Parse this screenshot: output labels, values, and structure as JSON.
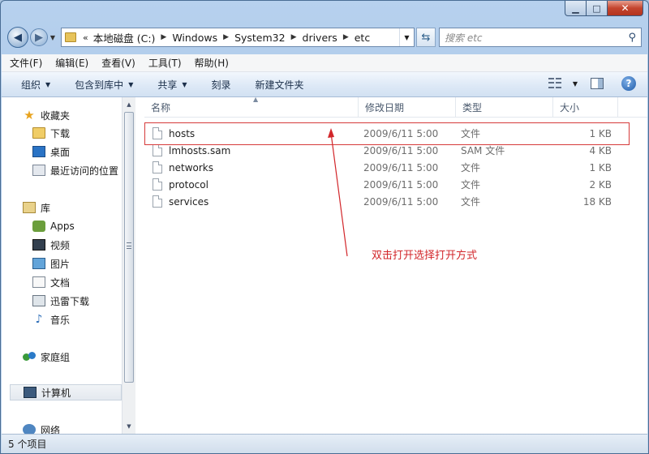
{
  "window": {
    "buttons": {
      "minimize": "▁",
      "maximize": "□",
      "close": "✕"
    }
  },
  "navigation": {
    "back_icon": "back-arrow-icon",
    "forward_icon": "forward-arrow-icon",
    "back_glyph": "◀",
    "forward_glyph": "▶"
  },
  "address": {
    "overflow_glyph": "«",
    "crumbs": [
      "本地磁盘 (C:)",
      "Windows",
      "System32",
      "drivers",
      "etc"
    ]
  },
  "search": {
    "placeholder": "搜索 etc"
  },
  "menu": [
    "文件(F)",
    "编辑(E)",
    "查看(V)",
    "工具(T)",
    "帮助(H)"
  ],
  "toolbar": {
    "items": [
      {
        "label": "组织",
        "has_caret": true
      },
      {
        "label": "包含到库中",
        "has_caret": true
      },
      {
        "label": "共享",
        "has_caret": true
      },
      {
        "label": "刻录",
        "has_caret": false
      },
      {
        "label": "新建文件夹",
        "has_caret": false
      }
    ]
  },
  "sidebar": {
    "items": [
      {
        "label": "收藏夹",
        "icon": "star-icon"
      },
      {
        "label": "下载",
        "icon": "downloads-folder-icon"
      },
      {
        "label": "桌面",
        "icon": "desktop-icon"
      },
      {
        "label": "最近访问的位置",
        "icon": "recent-places-icon"
      },
      {
        "label": "库",
        "icon": "libraries-icon"
      },
      {
        "label": "Apps",
        "icon": "apps-icon"
      },
      {
        "label": "视频",
        "icon": "video-icon"
      },
      {
        "label": "图片",
        "icon": "pictures-icon"
      },
      {
        "label": "文档",
        "icon": "documents-icon"
      },
      {
        "label": "迅雷下载",
        "icon": "thunder-download-icon"
      },
      {
        "label": "音乐",
        "icon": "music-icon"
      },
      {
        "label": "家庭组",
        "icon": "homegroup-icon"
      },
      {
        "label": "计算机",
        "icon": "computer-icon"
      },
      {
        "label": "网络",
        "icon": "network-icon"
      }
    ]
  },
  "columns": [
    "名称",
    "修改日期",
    "类型",
    "大小"
  ],
  "files": [
    {
      "name": "hosts",
      "date": "2009/6/11 5:00",
      "type": "文件",
      "size": "1 KB"
    },
    {
      "name": "lmhosts.sam",
      "date": "2009/6/11 5:00",
      "type": "SAM 文件",
      "size": "4 KB"
    },
    {
      "name": "networks",
      "date": "2009/6/11 5:00",
      "type": "文件",
      "size": "1 KB"
    },
    {
      "name": "protocol",
      "date": "2009/6/11 5:00",
      "type": "文件",
      "size": "2 KB"
    },
    {
      "name": "services",
      "date": "2009/6/11 5:00",
      "type": "文件",
      "size": "18 KB"
    }
  ],
  "annotation": {
    "text": "双击打开选择打开方式",
    "color": "#d2262a"
  },
  "status": {
    "text": "5 个项目"
  },
  "colors": {
    "accent": "#1d5aa8",
    "highlight_border": "#d63a3a"
  }
}
